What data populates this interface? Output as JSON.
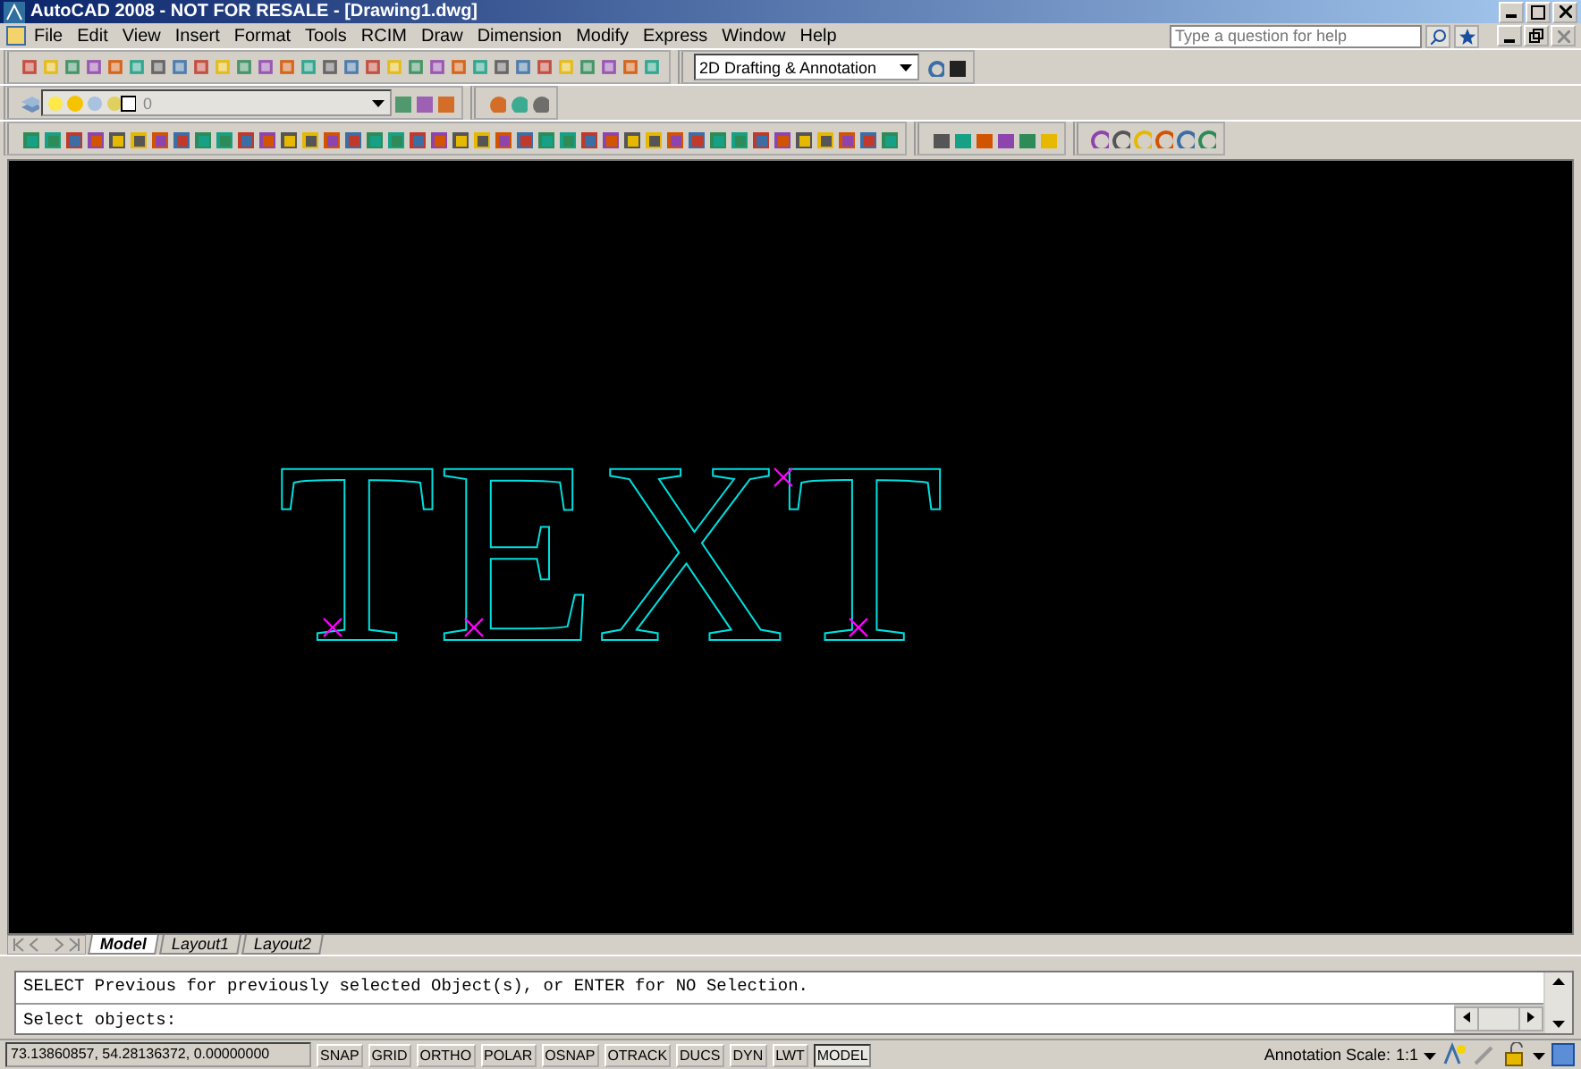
{
  "window": {
    "title": "AutoCAD 2008 - NOT FOR RESALE - [Drawing1.dwg]"
  },
  "menu": [
    "File",
    "Edit",
    "View",
    "Insert",
    "Format",
    "Tools",
    "RCIM",
    "Draw",
    "Dimension",
    "Modify",
    "Express",
    "Window",
    "Help"
  ],
  "help_search": {
    "placeholder": "Type a question for help"
  },
  "workspace_dropdown": {
    "value": "2D Drafting & Annotation"
  },
  "layer_dropdown": {
    "value": "0"
  },
  "drawing": {
    "text": "TEXT"
  },
  "layout_tabs": [
    {
      "label": "Model",
      "selected": true
    },
    {
      "label": "Layout1",
      "selected": false
    },
    {
      "label": "Layout2",
      "selected": false
    }
  ],
  "command_history": [
    "SELECT Previous for previously selected Object(s), or ENTER for NO Selection."
  ],
  "command_prompt": "Select objects:",
  "status_bar": {
    "coordinates": "73.13860857, 54.28136372, 0.00000000",
    "toggles": [
      {
        "label": "SNAP",
        "on": false
      },
      {
        "label": "GRID",
        "on": false
      },
      {
        "label": "ORTHO",
        "on": false
      },
      {
        "label": "POLAR",
        "on": false
      },
      {
        "label": "OSNAP",
        "on": false
      },
      {
        "label": "OTRACK",
        "on": false
      },
      {
        "label": "DUCS",
        "on": false
      },
      {
        "label": "DYN",
        "on": false
      },
      {
        "label": "LWT",
        "on": false
      },
      {
        "label": "MODEL",
        "on": true
      }
    ],
    "annotation_scale_label": "Annotation Scale:",
    "annotation_scale": "1:1"
  }
}
